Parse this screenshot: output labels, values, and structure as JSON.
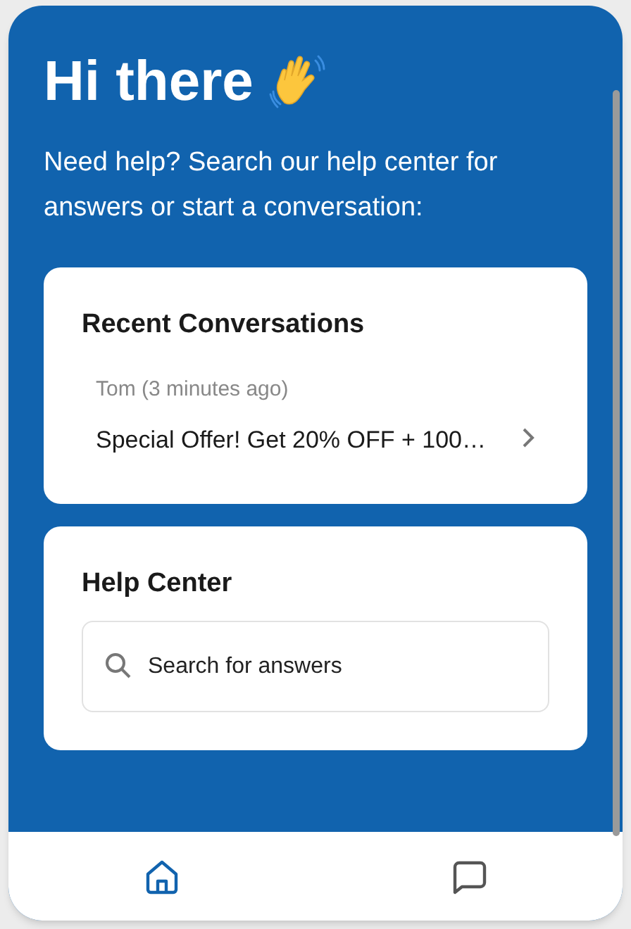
{
  "greeting": {
    "title": "Hi there",
    "subtitle": "Need help? Search our help center for answers or start a conversation:"
  },
  "recent_conversations": {
    "title": "Recent Conversations",
    "items": [
      {
        "sender": "Tom (3 minutes ago)",
        "preview": "Special Offer! Get 20% OFF + 100…"
      }
    ]
  },
  "help_center": {
    "title": "Help Center",
    "search": {
      "placeholder": "Search for answers"
    }
  },
  "nav_tabs": [
    {
      "kind": "home",
      "selected": true
    },
    {
      "kind": "messages",
      "selected": false
    }
  ]
}
